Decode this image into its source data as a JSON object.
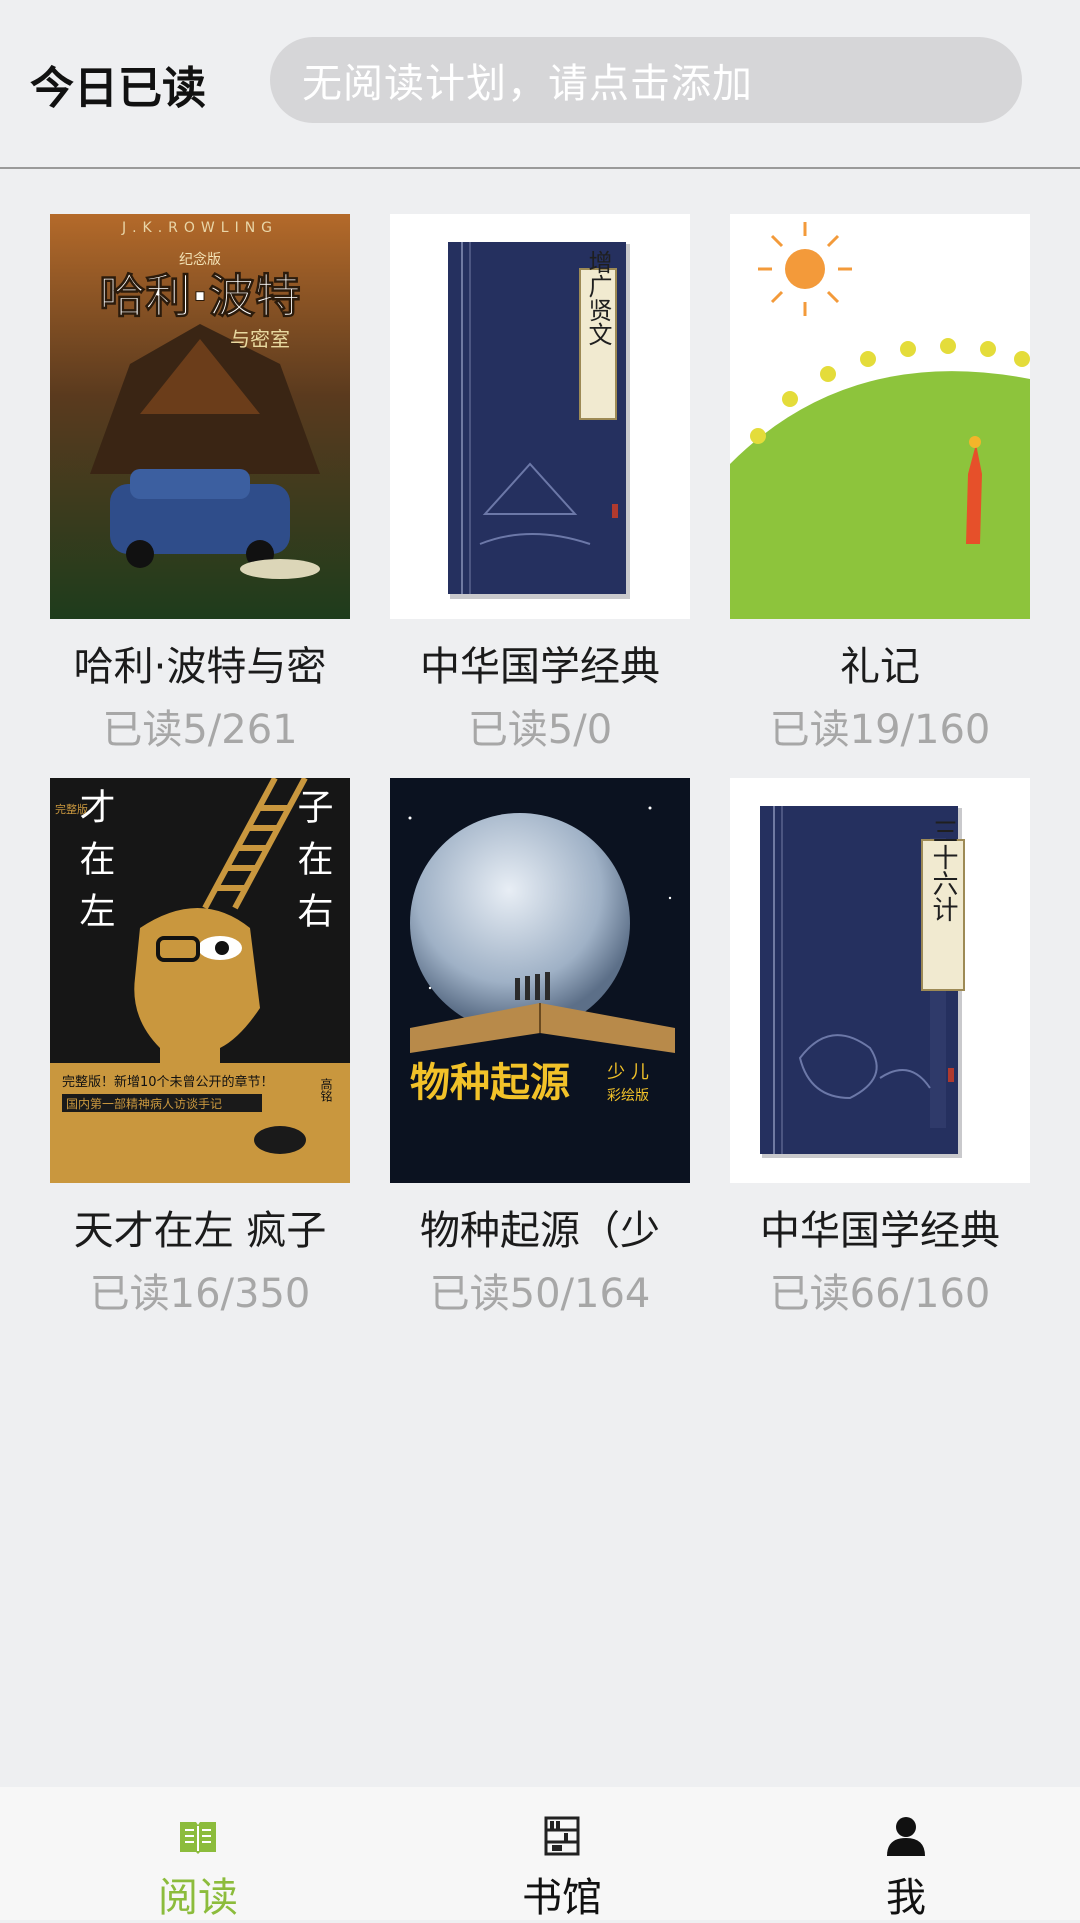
{
  "header": {
    "title": "今日已读",
    "plan_placeholder": "无阅读计划，请点击添加"
  },
  "books": [
    {
      "title": "哈利·波特与密",
      "progress": "已读5/261",
      "cover_text": {
        "author": "J.K.ROWLING",
        "badge": "纪念版",
        "main": "哈利·波特",
        "sub": "与密室"
      }
    },
    {
      "title": "中华国学经典",
      "progress": "已读5/0",
      "cover_text": {
        "main": "增广贤文"
      }
    },
    {
      "title": "礼记",
      "progress": "已读19/160",
      "cover_text": {}
    },
    {
      "title": "天才在左 疯子",
      "progress": "已读16/350",
      "cover_text": {
        "left": "天才在左",
        "right": "疯子在右",
        "tag": "完整版",
        "line1": "完整版！新增10个未曾公开的章节！",
        "line2": "国内第一部精神病人访谈手记",
        "author": "高铭"
      }
    },
    {
      "title": "物种起源（少",
      "progress": "已读50/164",
      "cover_text": {
        "main": "物种起源",
        "sub": "少 儿",
        "badge": "彩绘版"
      }
    },
    {
      "title": "中华国学经典",
      "progress": "已读66/160",
      "cover_text": {
        "main": "三十六计"
      }
    }
  ],
  "tabbar": {
    "tabs": [
      {
        "label": "阅读",
        "icon": "open-book-icon",
        "active": true
      },
      {
        "label": "书馆",
        "icon": "bookshelf-icon",
        "active": false
      },
      {
        "label": "我",
        "icon": "person-icon",
        "active": false
      }
    ]
  },
  "colors": {
    "accent": "#8cbc3c",
    "background": "#eeeff1",
    "plan_bar": "#d6d6d8",
    "progress_text": "#a7a7a7"
  }
}
